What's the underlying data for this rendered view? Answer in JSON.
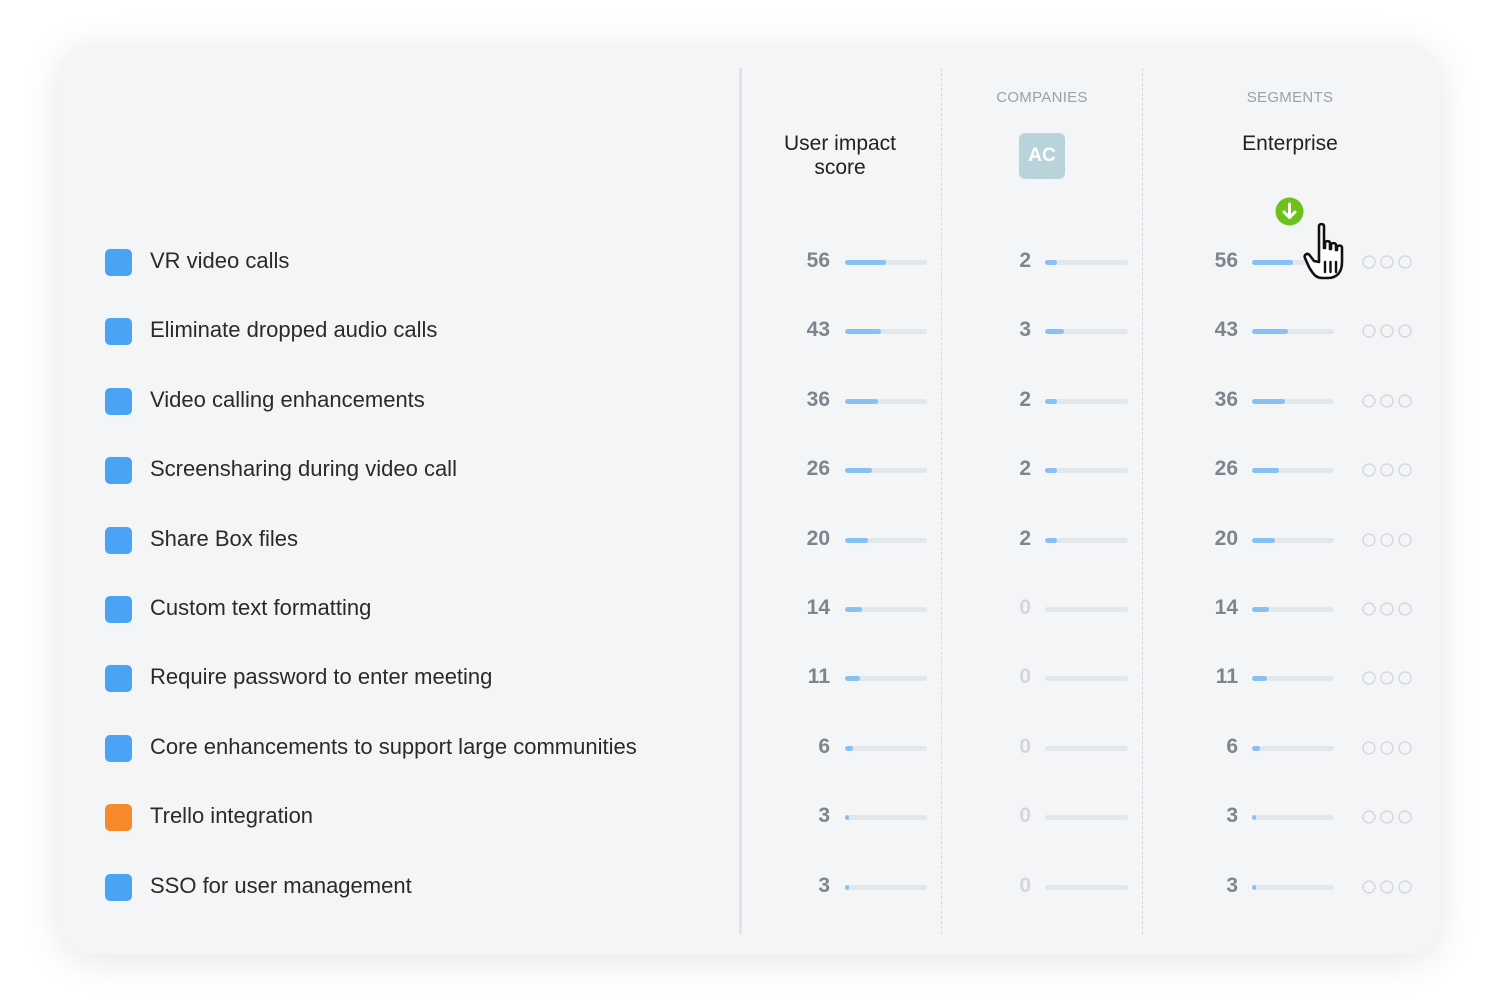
{
  "headers": {
    "score_title": "User impact score",
    "companies_group": "COMPANIES",
    "company_badge": "AC",
    "segments_group": "SEGMENTS",
    "segment_title": "Enterprise"
  },
  "colors": {
    "blue_square": "#4aa3f5",
    "orange_square": "#f78a2c",
    "bar_fill": "#86c0f4",
    "sort_icon": "#6cc21a"
  },
  "icons": {
    "sort": "arrow-down-circle-icon",
    "cursor": "hand-pointer-icon",
    "dots": "ellipsis-circles-icon"
  },
  "rows": [
    {
      "label": "VR video calls",
      "color": "blue",
      "score": "56",
      "score_level": 0.5,
      "company": "2",
      "company_level": 0.15,
      "segment": "56",
      "segment_level": 0.5
    },
    {
      "label": "Eliminate dropped audio calls",
      "color": "blue",
      "score": "43",
      "score_level": 0.44,
      "company": "3",
      "company_level": 0.23,
      "segment": "43",
      "segment_level": 0.44
    },
    {
      "label": "Video calling enhancements",
      "color": "blue",
      "score": "36",
      "score_level": 0.4,
      "company": "2",
      "company_level": 0.15,
      "segment": "36",
      "segment_level": 0.4
    },
    {
      "label": "Screensharing during video call",
      "color": "blue",
      "score": "26",
      "score_level": 0.33,
      "company": "2",
      "company_level": 0.15,
      "segment": "26",
      "segment_level": 0.33
    },
    {
      "label": "Share Box files",
      "color": "blue",
      "score": "20",
      "score_level": 0.28,
      "company": "2",
      "company_level": 0.15,
      "segment": "20",
      "segment_level": 0.28
    },
    {
      "label": "Custom text formatting",
      "color": "blue",
      "score": "14",
      "score_level": 0.21,
      "company": "0",
      "company_level": 0,
      "segment": "14",
      "segment_level": 0.21
    },
    {
      "label": "Require password to enter meeting",
      "color": "blue",
      "score": "11",
      "score_level": 0.18,
      "company": "0",
      "company_level": 0,
      "segment": "11",
      "segment_level": 0.18
    },
    {
      "label": "Core enhancements to support large communities",
      "color": "blue",
      "score": "6",
      "score_level": 0.1,
      "company": "0",
      "company_level": 0,
      "segment": "6",
      "segment_level": 0.1
    },
    {
      "label": "Trello integration",
      "color": "orange",
      "score": "3",
      "score_level": 0.05,
      "company": "0",
      "company_level": 0,
      "segment": "3",
      "segment_level": 0.05
    },
    {
      "label": "SSO for user management",
      "color": "blue",
      "score": "3",
      "score_level": 0.05,
      "company": "0",
      "company_level": 0,
      "segment": "3",
      "segment_level": 0.05
    }
  ]
}
